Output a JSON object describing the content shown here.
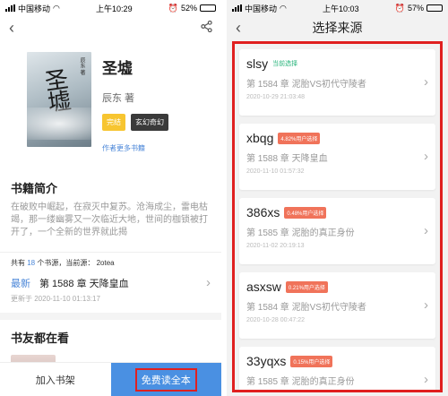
{
  "left": {
    "status": {
      "carrier": "中国移动",
      "time": "上午10:29",
      "battery": "52%",
      "battery_level": 0.52
    },
    "book": {
      "title": "圣墟",
      "cover_title": "圣墟",
      "cover_author": "辰东 著",
      "author": "辰东 著",
      "tags": [
        "完结",
        "玄幻奇幻"
      ],
      "more_link": "作者更多书籍"
    },
    "intro": {
      "title": "书籍简介",
      "text": "在破败中崛起，在寂灭中复苏。沧海成尘，雷电枯竭，那一缕幽雾又一次临近大地，世间的枷锁被打开了，一个全新的世界就此揭"
    },
    "sources": {
      "prefix": "共有",
      "count": "18",
      "middle": "个书源，当前源：",
      "current": "2otea"
    },
    "latest": {
      "label": "最新",
      "chapter": "第 1588 章 天降皇血",
      "updated": "更新于 2020-11-10 01:13:17"
    },
    "readers": {
      "title": "书友都在看"
    },
    "bottom": {
      "add_shelf": "加入书架",
      "read_free": "免费读全本"
    }
  },
  "right": {
    "status": {
      "carrier": "中国移动",
      "time": "上午10:03",
      "battery": "57%",
      "battery_level": 0.57
    },
    "title": "选择来源",
    "cards": [
      {
        "name": "slsy",
        "tag": "当前选择",
        "tag_type": "current",
        "chapter": "第 1584 章 泥胎VS初代守陵者",
        "time": "2020-10-29 21:03:48"
      },
      {
        "name": "xbqg",
        "tag": "4.82%用户选择",
        "tag_type": "rate",
        "chapter": "第 1588 章 天降皇血",
        "time": "2020-11-10 01:57:32"
      },
      {
        "name": "386xs",
        "tag": "0.48%用户选择",
        "tag_type": "rate",
        "chapter": "第 1585 章 泥胎的真正身份",
        "time": "2020-11-02 20:19:13"
      },
      {
        "name": "asxsw",
        "tag": "0.21%用户选择",
        "tag_type": "rate",
        "chapter": "第 1584 章 泥胎VS初代守陵者",
        "time": "2020-10-28 00:47:22"
      },
      {
        "name": "33yqxs",
        "tag": "0.15%用户选择",
        "tag_type": "rate",
        "chapter": "第 1585 章 泥胎的真正身份",
        "time": "2020-10-30 05:22:13"
      }
    ]
  },
  "colors": {
    "accent": "#4a86d8",
    "highlight_frame": "#e02020",
    "rate_tag": "#f0735a",
    "current_tag": "#26b37a"
  },
  "icons": {
    "back": "chevron-left-icon",
    "share": "share-icon",
    "row_arrow": "chevron-right-icon"
  }
}
